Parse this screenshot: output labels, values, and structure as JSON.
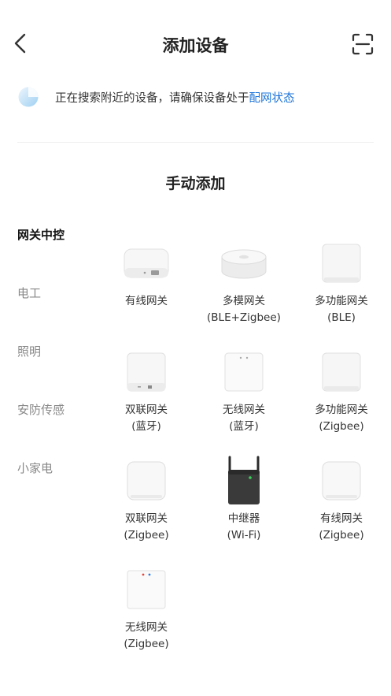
{
  "header": {
    "title": "添加设备"
  },
  "search": {
    "text": "正在搜索附近的设备，请确保设备处于",
    "link": "配网状态",
    "link_color": "#1a73d8"
  },
  "section": {
    "title": "手动添加"
  },
  "categories": [
    {
      "label": "网关中控",
      "active": true
    },
    {
      "label": "电工",
      "active": false
    },
    {
      "label": "照明",
      "active": false
    },
    {
      "label": "安防传感",
      "active": false
    },
    {
      "label": "小家电",
      "active": false
    }
  ],
  "devices": [
    {
      "line1": "有线网关",
      "line2": "",
      "icon": "wired-gateway-icon"
    },
    {
      "line1": "多模网关",
      "line2": "(BLE+Zigbee)",
      "icon": "multimode-gateway-icon"
    },
    {
      "line1": "多功能网关",
      "line2": "(BLE)",
      "icon": "multifunction-gateway-icon"
    },
    {
      "line1": "双联网关",
      "line2": "(蓝牙)",
      "icon": "dual-gateway-icon"
    },
    {
      "line1": "无线网关",
      "line2": "(蓝牙)",
      "icon": "wireless-gateway-icon"
    },
    {
      "line1": "多功能网关",
      "line2": "(Zigbee)",
      "icon": "multifunction-gateway-icon"
    },
    {
      "line1": "双联网关",
      "line2": "(Zigbee)",
      "icon": "dual-gateway-icon"
    },
    {
      "line1": "中继器",
      "line2": "(Wi-Fi)",
      "icon": "repeater-icon"
    },
    {
      "line1": "有线网关",
      "line2": "(Zigbee)",
      "icon": "wired-gateway-icon"
    },
    {
      "line1": "无线网关",
      "line2": "(Zigbee)",
      "icon": "wireless-gateway-icon"
    }
  ]
}
